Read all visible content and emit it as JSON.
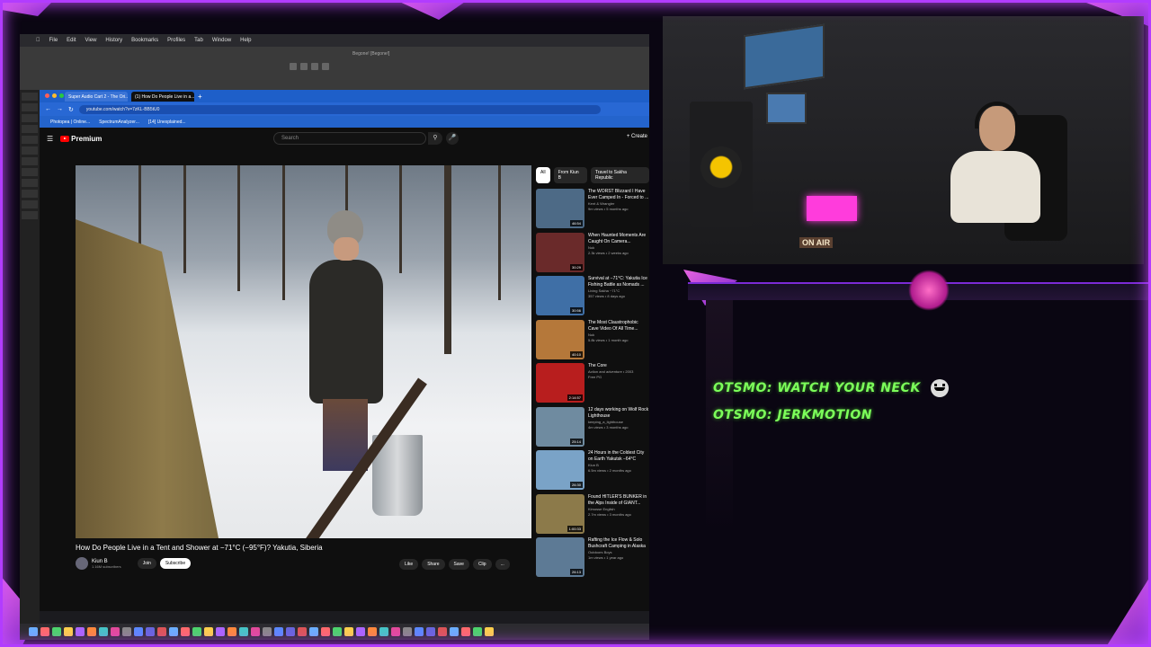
{
  "mac_menu": [
    "File",
    "Edit",
    "View",
    "History",
    "Bookmarks",
    "Profiles",
    "Tab",
    "Window",
    "Help"
  ],
  "daw": {
    "title": "Begone! [Begone!]"
  },
  "browser": {
    "tabs": [
      "Super Audio Cart 2 - The Ori...",
      "(1) How Do People Live in a..."
    ],
    "url": "youtube.com/watch?v=7zKL-BB5tU0",
    "bookmarks": [
      "Photopea | Online...",
      "SpectrumAnalyzer...",
      "[14] Unexplained..."
    ]
  },
  "youtube": {
    "brand": "Premium",
    "search_placeholder": "Search",
    "create_label": "+ Create",
    "video_title": "How Do People Live in a Tent and Shower at −71°C (−95°F)? Yakutia, Siberia",
    "channel": {
      "name": "Kiun B",
      "subs": "1.16M subscribers",
      "join": "Join",
      "subscribe": "Subscribe"
    },
    "actions": [
      "Like",
      "Share",
      "Save",
      "Clip",
      "..."
    ],
    "chips": [
      "All",
      "From Kiun B",
      "Travel to Sakha Republic"
    ],
    "recommendations": [
      {
        "title": "The WORST Blizzard I Have Ever Camped In - Forced to ...",
        "channel": "Kent & Wrangler",
        "meta": "9m views • 5 months ago",
        "duration": "46:54",
        "color": "#4d6a86"
      },
      {
        "title": "When Haunted Moments Are Caught On Camera...",
        "channel": "Nuk",
        "meta": "2.3k views • 2 weeks ago",
        "duration": "30:29",
        "color": "#6a2a2a"
      },
      {
        "title": "Survival at −71°C: Yakutia Ice Fishing Battle as Nomads ...",
        "channel": "Living Sakha ~71°C",
        "meta": "357 views • 8 days ago",
        "duration": "30:56",
        "color": "#3f6fa6"
      },
      {
        "title": "The Most Claustrophobic Cave Video Of All Time...",
        "channel": "Nuk",
        "meta": "5.8k views • 1 month ago",
        "duration": "40:10",
        "color": "#b5783a"
      },
      {
        "title": "The Core",
        "channel": "Action and adventure • 2003",
        "meta": "Free  PG",
        "duration": "2:14:57",
        "color": "#b81e1e"
      },
      {
        "title": "12 days working on Wolf Rock Lighthouse",
        "channel": "keeping_a_lighthouse",
        "meta": "4m views • 3 months ago",
        "duration": "25:14",
        "color": "#6f8ba0"
      },
      {
        "title": "24 Hours in the Coldest City on Earth Yakutsk −64°C (−83°F)",
        "channel": "Kiun B",
        "meta": "6.5m views • 2 months ago",
        "duration": "26:30",
        "color": "#7aa3c7"
      },
      {
        "title": "Found HITLER'S BUNKER in the Alps Inside of GIANT...",
        "channel": "Kimosse English",
        "meta": "2.7m views • 3 months ago",
        "duration": "1:00:33",
        "color": "#8c7a4a"
      },
      {
        "title": "Rafting the Ice Flow & Solo Bushcraft Camping in Alaska",
        "channel": "Outdoors Boys",
        "meta": "1m views • 1 year ago",
        "duration": "26:13",
        "color": "#5d7a95"
      }
    ]
  },
  "webcam": {
    "sign": "ON AIR"
  },
  "chat": [
    {
      "user": "OTSMO:",
      "message": "WATCH YOUR NECK"
    },
    {
      "user": "OTSMO:",
      "message": "JERKMOTION"
    }
  ],
  "colors": {
    "accent": "#b23cff",
    "chat_text": "#7cff5a",
    "yt_red": "#ff0000",
    "browser_blue": "#2868d4"
  }
}
